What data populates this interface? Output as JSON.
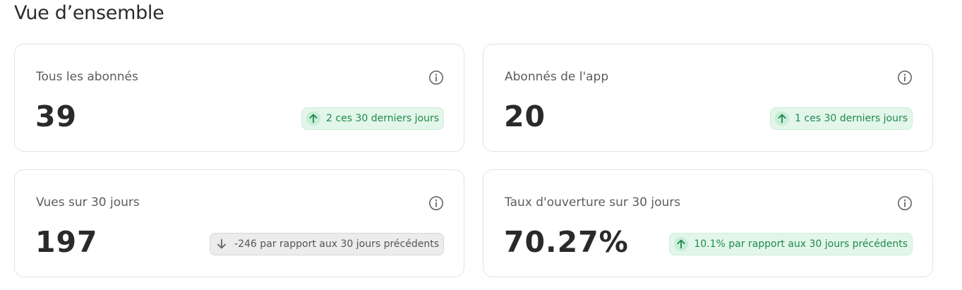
{
  "page": {
    "title": "Vue d’ensemble"
  },
  "cards": [
    {
      "label": "Tous les abonnés",
      "value": "39",
      "trend": "up",
      "change": "2 ces 30 derniers jours"
    },
    {
      "label": "Abonnés de l'app",
      "value": "20",
      "trend": "up",
      "change": "1 ces 30 derniers jours"
    },
    {
      "label": "Vues sur 30 jours",
      "value": "197",
      "trend": "down",
      "change": "-246 par rapport aux 30 jours précédents"
    },
    {
      "label": "Taux d'ouverture sur 30 jours",
      "value": "70.27%",
      "trend": "up",
      "change": "10.1% par rapport aux 30 jours précédents"
    }
  ],
  "icons": {
    "info": "info-icon",
    "up": "arrow-up-icon",
    "down": "arrow-down-icon"
  },
  "colors": {
    "positive": "#1f8a4c",
    "positive_bg": "#e3f6ea",
    "neutral": "#555555",
    "neutral_bg": "#ececec"
  }
}
